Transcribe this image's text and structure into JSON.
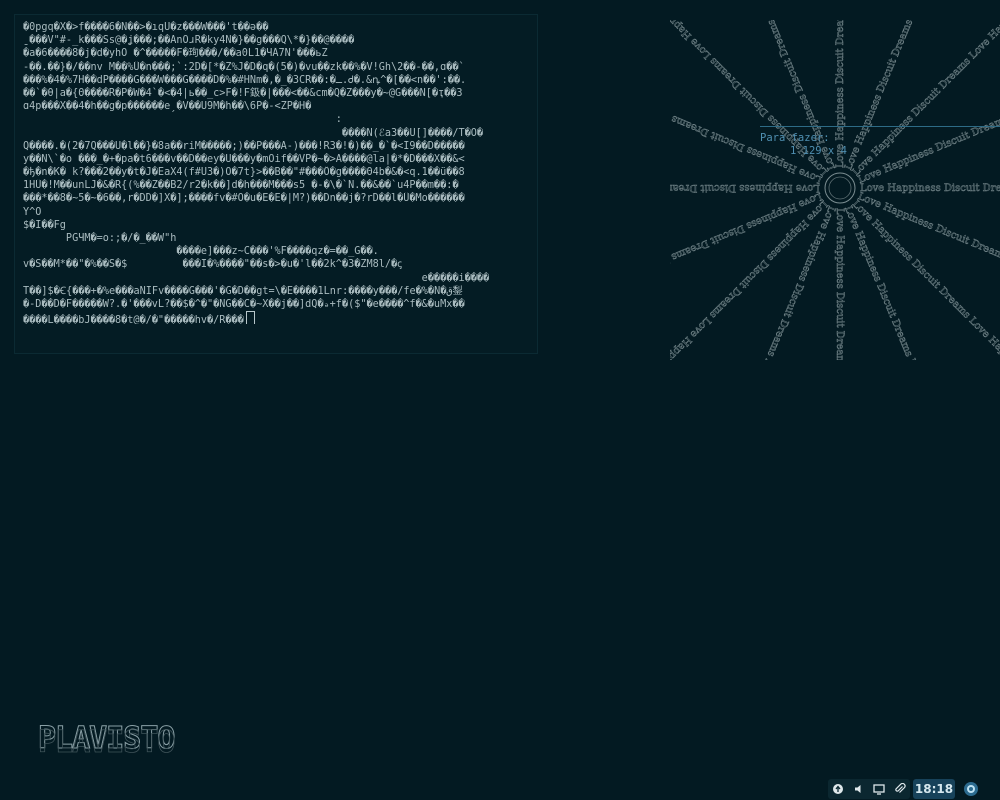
{
  "terminal": {
    "lines": [
      "�0pgq�X�>f����6�N��>�ıqU�z���W���'t��ə��",
      "ˍ���V\"#-_k���Ss@�ʝ���;��AnOɹR�ky4N�}��g���Q\\*�}��@����",
      "�a�6����8�j�d�yhO �^�����F�珣���/��a0L1�ЧÃ7N'���ьZ",
      "-��.��}�/��nv M��%Û�n���;`:2D�[*�Z%J�D�q�(5�)�vu��zk��%�V!Gh\\2��-��,ɑ��`",
      "���%�4�%7H��dP����G���W���G����D�%�#HNm�,�_�3CR��:�ـ.Ꮷ�.&ꝴ^�[��<n��':��.",
      "��`�θ|a�{Θ����R�P�W�4`�<�4|ь��_c>F�!F鈒�|���<��&cm�Q�Z���y�~@G���N[�ҭ��3",
      "ɑ4p���X��4�h��g�p������eˏ�V��U9M�h��\\6P�-<ZP�H�",
      "                                                   :",
      "                                                    ����N(ℰa3��U[]����/T�O�",
      "Q����.�(2�7Q���U�l��}�8a��riM�����;)��P���A-)���!R3�!�)��_�`�<I9��D�����",
      "y��N\\`�o ���_�+�pa�t6���v��D��ey�U���y�mOif��VP�~�>A����@la|�*�D���X��&<",
      "�ђ�n�K� k?���2��y�t�J�EaX4(f#U3�)O�7t}>��B��\"#���Ô�g����Θ4b�&�<q.1��ü��8",
      "1HÜ�!M��unLJ�&�R{(%��Z��B2/r2�k��]d�h���M���s5 �-�\\�`N.��&��`u4P��m��:�",
      "���*��8�~5�~�6��,r�DD�]X�];����fv�#O�u�E�E�|M?)��Dn��j�?rD��l�Û�Mo������",
      "Y^O",
      "$�I��Fg",
      "       PGЧM�=o:;�/�_��W\"h",
      "                         ����e]���z~C���'%F����qz�=��_G��.",
      "v�S��M*��\"�%��S�$         ���I�%����\"��s�>�u�'l��2k^�3�ZM8l/�ꞔ",
      "                                                                 e�����i����",
      "T��]$�Ꞓ{���+�%e���aNIFv����G���'�G�D��gt=\\�E����1Lnr:����y���/fe�%�N�ق鋫",
      "�-D��D�F�����W?.�'���vL?��$�^�\"�NG��C�~X��j��]dQ�ₔ+f�($\"�e����^f�&�uMx��",
      "����L����bJ����8�t@�/�\"�����hv�/R���"
    ]
  },
  "sunburst": {
    "words": [
      "Love",
      "Happiness",
      "Discuit",
      "Dreams"
    ],
    "ray_count": 16
  },
  "todo": {
    "title": "Para fazer:",
    "count": "1 129 x 4"
  },
  "logo": {
    "text": "PLAVISTO"
  },
  "tray": {
    "icons": [
      "network-icon",
      "volume-icon",
      "display-icon",
      "paperclip-icon"
    ]
  },
  "clock": {
    "time": "18:18"
  },
  "colors": {
    "background": "#031a22",
    "terminal_text": "#a9bbbf",
    "accent_blue": "#4f8fb1",
    "clock_bg": "#17425a"
  }
}
